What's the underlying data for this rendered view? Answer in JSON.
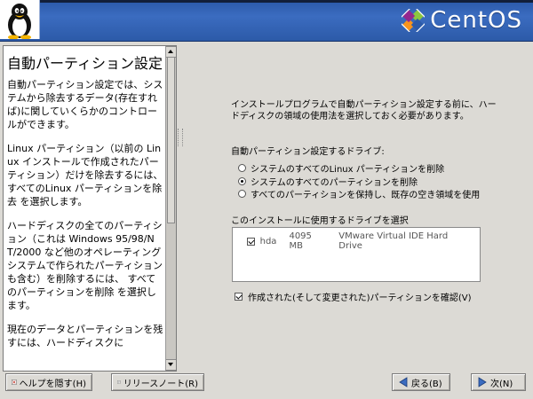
{
  "header": {
    "brand": "CentOS",
    "colors": {
      "banner": "#2c5aa8",
      "accent_green": "#8cc63f",
      "accent_purple": "#93278f",
      "accent_orange": "#f7941d"
    }
  },
  "help": {
    "title": "自動パーティション設定",
    "paragraphs": [
      "自動パーティション設定では、システムから除去するデータ(存在すれば)に関していくらかのコントロールができます。",
      "Linux パーティション（以前の Linux インストールで作成されたパーティション）だけを除去するには、すべてのLinux パーティションを除去 を選択します。",
      "ハードディスクの全てのパーティション（これは Windows 95/98/NT/2000 など他のオペレーティングシステムで作られたパーティションも含む）を削除するには、 すべてのパーティションを削除 を選択します。",
      "現在のデータとパーティションを残すには、ハードディスクに"
    ]
  },
  "main": {
    "intro": "インストールプログラムで自動パーティション設定する前に、ハードディスクの領域の使用法を選択しておく必要があります。",
    "drive_label": "自動パーティション設定するドライブ:",
    "options": [
      {
        "label": "システムのすべてのLinux パーティションを削除",
        "checked": false
      },
      {
        "label": "システムのすべてのパーティションを削除",
        "checked": true
      },
      {
        "label": "すべてのパーティションを保持し、既存の空き領域を使用",
        "checked": false
      }
    ],
    "drives_label": "このインストールに使用するドライブを選択",
    "drives": [
      {
        "checked": true,
        "name": "hda",
        "size": "4095 MB",
        "model": "VMware Virtual IDE Hard Drive"
      }
    ],
    "review_label": "作成された(そして変更された)パーティションを確認(V)",
    "review_checked": true
  },
  "buttons": {
    "hide_help": "ヘルプを隠す(H)",
    "release_notes": "リリースノート(R)",
    "back": "戻る(B)",
    "next": "次(N)"
  }
}
